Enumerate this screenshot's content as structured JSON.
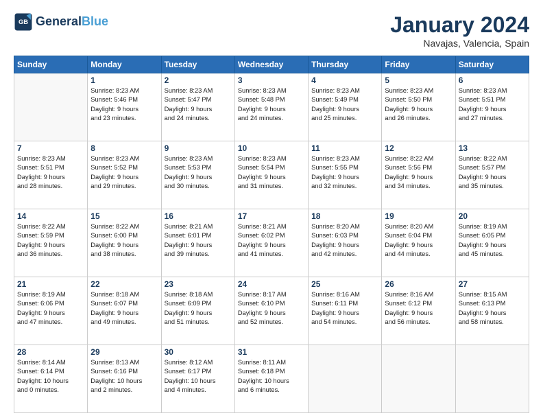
{
  "header": {
    "logo_line1": "General",
    "logo_line2": "Blue",
    "title": "January 2024",
    "subtitle": "Navajas, Valencia, Spain"
  },
  "columns": [
    "Sunday",
    "Monday",
    "Tuesday",
    "Wednesday",
    "Thursday",
    "Friday",
    "Saturday"
  ],
  "weeks": [
    [
      {
        "day": "",
        "info": ""
      },
      {
        "day": "1",
        "info": "Sunrise: 8:23 AM\nSunset: 5:46 PM\nDaylight: 9 hours\nand 23 minutes."
      },
      {
        "day": "2",
        "info": "Sunrise: 8:23 AM\nSunset: 5:47 PM\nDaylight: 9 hours\nand 24 minutes."
      },
      {
        "day": "3",
        "info": "Sunrise: 8:23 AM\nSunset: 5:48 PM\nDaylight: 9 hours\nand 24 minutes."
      },
      {
        "day": "4",
        "info": "Sunrise: 8:23 AM\nSunset: 5:49 PM\nDaylight: 9 hours\nand 25 minutes."
      },
      {
        "day": "5",
        "info": "Sunrise: 8:23 AM\nSunset: 5:50 PM\nDaylight: 9 hours\nand 26 minutes."
      },
      {
        "day": "6",
        "info": "Sunrise: 8:23 AM\nSunset: 5:51 PM\nDaylight: 9 hours\nand 27 minutes."
      }
    ],
    [
      {
        "day": "7",
        "info": "Sunrise: 8:23 AM\nSunset: 5:51 PM\nDaylight: 9 hours\nand 28 minutes."
      },
      {
        "day": "8",
        "info": "Sunrise: 8:23 AM\nSunset: 5:52 PM\nDaylight: 9 hours\nand 29 minutes."
      },
      {
        "day": "9",
        "info": "Sunrise: 8:23 AM\nSunset: 5:53 PM\nDaylight: 9 hours\nand 30 minutes."
      },
      {
        "day": "10",
        "info": "Sunrise: 8:23 AM\nSunset: 5:54 PM\nDaylight: 9 hours\nand 31 minutes."
      },
      {
        "day": "11",
        "info": "Sunrise: 8:23 AM\nSunset: 5:55 PM\nDaylight: 9 hours\nand 32 minutes."
      },
      {
        "day": "12",
        "info": "Sunrise: 8:22 AM\nSunset: 5:56 PM\nDaylight: 9 hours\nand 34 minutes."
      },
      {
        "day": "13",
        "info": "Sunrise: 8:22 AM\nSunset: 5:57 PM\nDaylight: 9 hours\nand 35 minutes."
      }
    ],
    [
      {
        "day": "14",
        "info": "Sunrise: 8:22 AM\nSunset: 5:59 PM\nDaylight: 9 hours\nand 36 minutes."
      },
      {
        "day": "15",
        "info": "Sunrise: 8:22 AM\nSunset: 6:00 PM\nDaylight: 9 hours\nand 38 minutes."
      },
      {
        "day": "16",
        "info": "Sunrise: 8:21 AM\nSunset: 6:01 PM\nDaylight: 9 hours\nand 39 minutes."
      },
      {
        "day": "17",
        "info": "Sunrise: 8:21 AM\nSunset: 6:02 PM\nDaylight: 9 hours\nand 41 minutes."
      },
      {
        "day": "18",
        "info": "Sunrise: 8:20 AM\nSunset: 6:03 PM\nDaylight: 9 hours\nand 42 minutes."
      },
      {
        "day": "19",
        "info": "Sunrise: 8:20 AM\nSunset: 6:04 PM\nDaylight: 9 hours\nand 44 minutes."
      },
      {
        "day": "20",
        "info": "Sunrise: 8:19 AM\nSunset: 6:05 PM\nDaylight: 9 hours\nand 45 minutes."
      }
    ],
    [
      {
        "day": "21",
        "info": "Sunrise: 8:19 AM\nSunset: 6:06 PM\nDaylight: 9 hours\nand 47 minutes."
      },
      {
        "day": "22",
        "info": "Sunrise: 8:18 AM\nSunset: 6:07 PM\nDaylight: 9 hours\nand 49 minutes."
      },
      {
        "day": "23",
        "info": "Sunrise: 8:18 AM\nSunset: 6:09 PM\nDaylight: 9 hours\nand 51 minutes."
      },
      {
        "day": "24",
        "info": "Sunrise: 8:17 AM\nSunset: 6:10 PM\nDaylight: 9 hours\nand 52 minutes."
      },
      {
        "day": "25",
        "info": "Sunrise: 8:16 AM\nSunset: 6:11 PM\nDaylight: 9 hours\nand 54 minutes."
      },
      {
        "day": "26",
        "info": "Sunrise: 8:16 AM\nSunset: 6:12 PM\nDaylight: 9 hours\nand 56 minutes."
      },
      {
        "day": "27",
        "info": "Sunrise: 8:15 AM\nSunset: 6:13 PM\nDaylight: 9 hours\nand 58 minutes."
      }
    ],
    [
      {
        "day": "28",
        "info": "Sunrise: 8:14 AM\nSunset: 6:14 PM\nDaylight: 10 hours\nand 0 minutes."
      },
      {
        "day": "29",
        "info": "Sunrise: 8:13 AM\nSunset: 6:16 PM\nDaylight: 10 hours\nand 2 minutes."
      },
      {
        "day": "30",
        "info": "Sunrise: 8:12 AM\nSunset: 6:17 PM\nDaylight: 10 hours\nand 4 minutes."
      },
      {
        "day": "31",
        "info": "Sunrise: 8:11 AM\nSunset: 6:18 PM\nDaylight: 10 hours\nand 6 minutes."
      },
      {
        "day": "",
        "info": ""
      },
      {
        "day": "",
        "info": ""
      },
      {
        "day": "",
        "info": ""
      }
    ]
  ]
}
